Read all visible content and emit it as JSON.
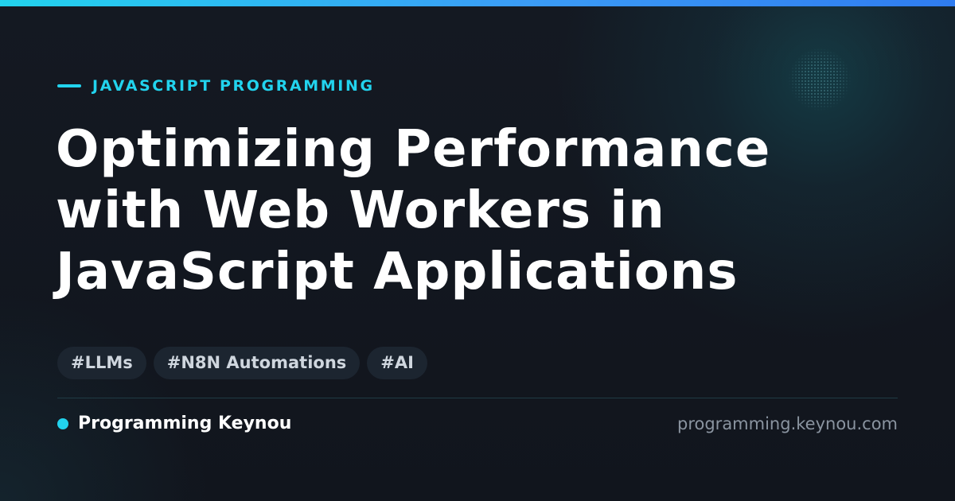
{
  "accent_color": "#22d3ee",
  "background_color": "#12161f",
  "eyebrow": {
    "icon": "dash-line-icon",
    "text": "JAVASCRIPT PROGRAMMING"
  },
  "title": {
    "lines": [
      "Optimizing Performance",
      "with Web Workers in",
      "JavaScript Applications"
    ]
  },
  "tags": [
    "#LLMs",
    "#N8N Automations",
    "#AI"
  ],
  "footer": {
    "brand_icon": "dot-icon",
    "brand_name": "Programming Keynou",
    "site_url": "programming.keynou.com"
  }
}
